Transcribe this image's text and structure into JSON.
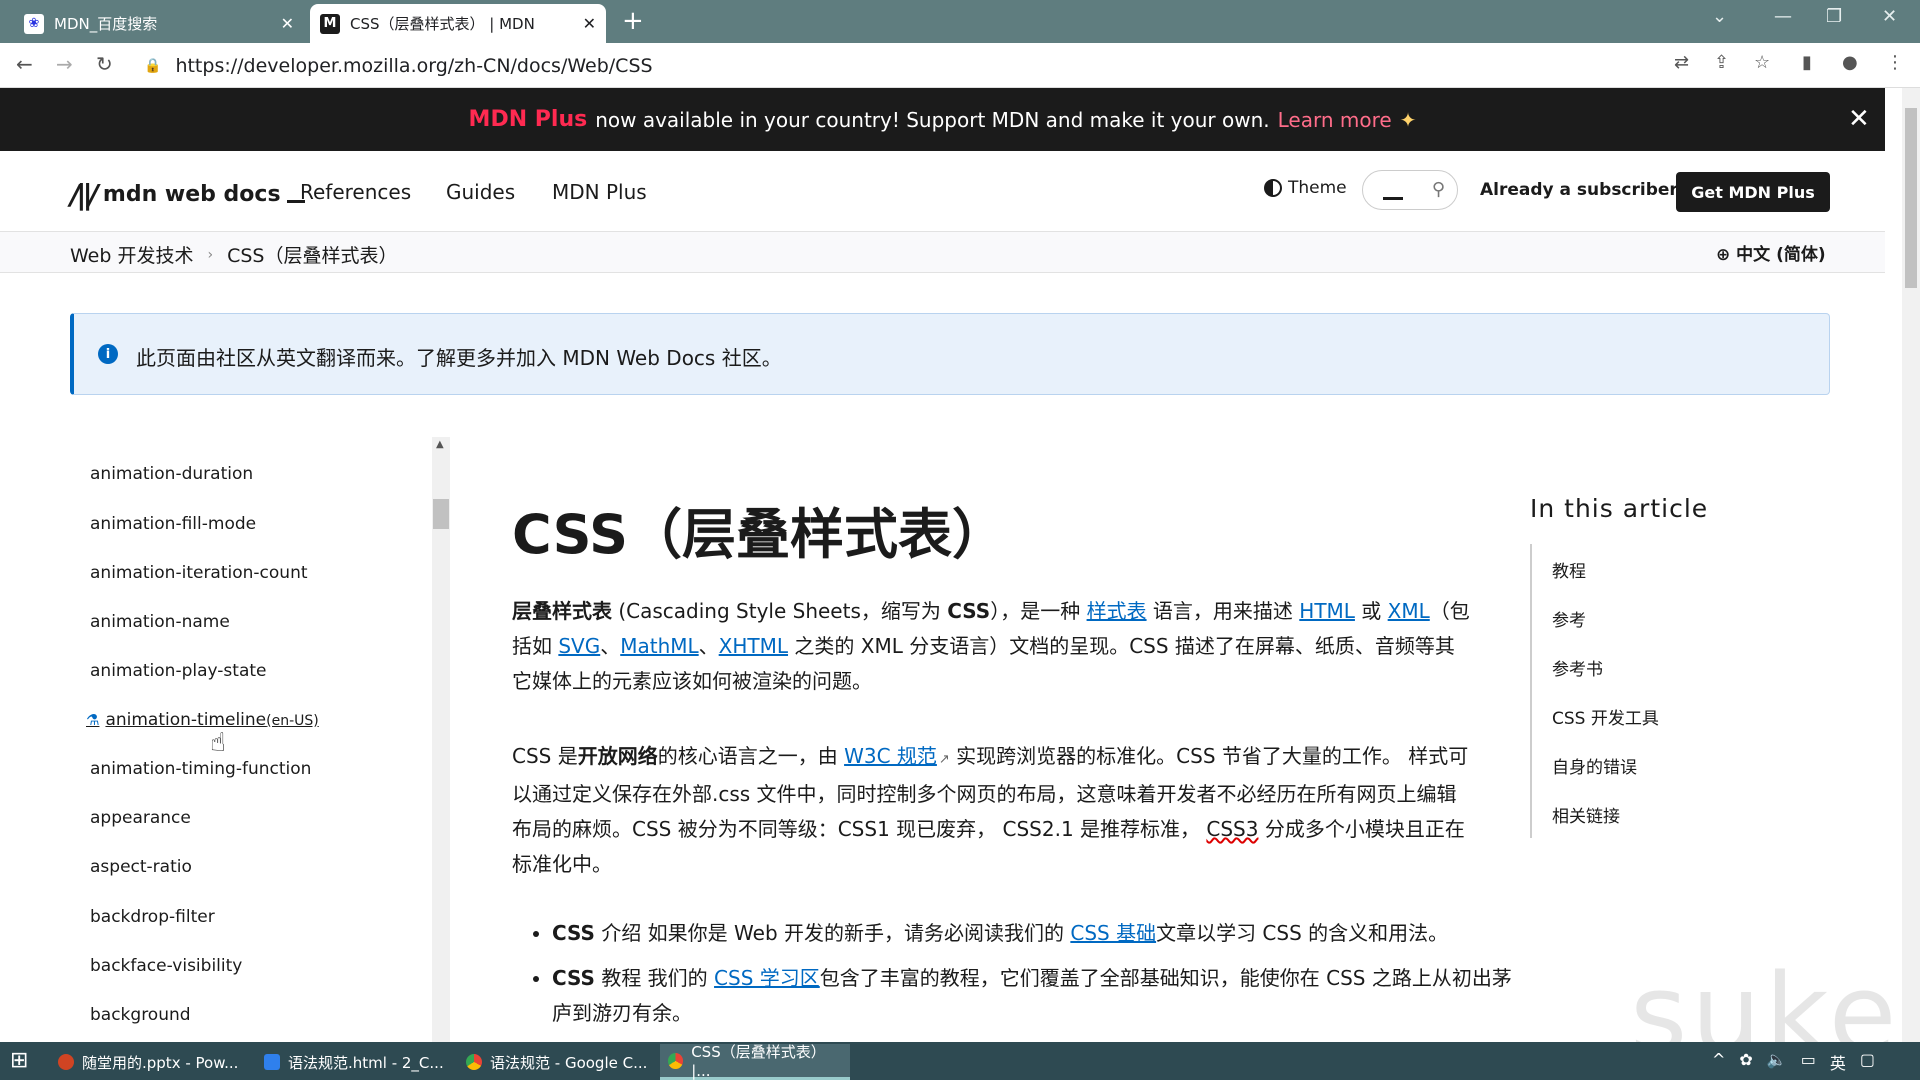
{
  "browser": {
    "tabs": [
      {
        "title": "MDN_百度搜索",
        "active": false
      },
      {
        "title": "CSS（层叠样式表） | MDN",
        "active": true
      }
    ],
    "url": "https://developer.mozilla.org/zh-CN/docs/Web/CSS"
  },
  "banner": {
    "brand": "MDN Plus",
    "text": "now available in your country! Support MDN and make it your own.",
    "link": "Learn more"
  },
  "header": {
    "logo": "mdn web docs",
    "nav": [
      "References",
      "Guides",
      "MDN Plus"
    ],
    "theme": "Theme",
    "subscriber": "Already a subscriber?",
    "cta": "Get MDN Plus"
  },
  "breadcrumb": {
    "items": [
      "Web 开发技术",
      "CSS（层叠样式表）"
    ],
    "language": "中文 (简体)"
  },
  "notice": {
    "text": "此页面由社区从英文翻译而来。了解更多并加入 MDN Web Docs 社区。"
  },
  "sidebar": {
    "items": [
      "animation-duration",
      "animation-fill-mode",
      "animation-iteration-count",
      "animation-name",
      "animation-play-state",
      "animation-timeline",
      "animation-timing-function",
      "appearance",
      "aspect-ratio",
      "backdrop-filter",
      "backface-visibility",
      "background"
    ],
    "experimental_suffix": "(en-US)"
  },
  "article": {
    "title": "CSS（层叠样式表）",
    "p1": {
      "t1": "层叠样式表",
      "t2": " (Cascading Style Sheets，缩写为 ",
      "t3": "CSS",
      "t4": "），是一种 ",
      "l1": "样式表",
      "t5": " 语言，用来描述 ",
      "l2": "HTML",
      "t6": " 或 ",
      "l3": "XML",
      "t7": "（包括如 ",
      "l4": "SVG",
      "t8": "、",
      "l5": "MathML",
      "t9": "、",
      "l6": "XHTML",
      "t10": " 之类的 XML 分支语言）文档的呈现。CSS 描述了在屏幕、纸质、音频等其它媒体上的元素应该如何被渲染的问题。"
    },
    "p2": {
      "t1": "CSS 是",
      "t2": "开放网络",
      "t3": "的核心语言之一，由 ",
      "l1": "W3C 规范",
      "t4": " 实现跨浏览器的标准化。CSS 节省了大量的工作。 样式可以通过定义保存在外部.css 文件中，同时控制多个网页的布局，这意味着开发者不必经历在所有网页上编辑布局的麻烦。CSS 被分为不同等级：CSS1 现已废弃， CSS2.1 是推荐标准， ",
      "l2": "CSS3",
      "t5": " 分成多个小模块且正在标准化中。"
    },
    "bullets": [
      {
        "b": "CSS",
        "t1": " 介绍 如果你是 Web 开发的新手，请务必阅读我们的 ",
        "l": "CSS 基础",
        "t2": "文章以学习 CSS 的含义和用法。"
      },
      {
        "b": "CSS",
        "t1": " 教程 我们的 ",
        "l": "CSS 学习区",
        "t2": "包含了丰富的教程，它们覆盖了全部基础知识，能使你在 CSS 之路上从初出茅庐到游刃有余。"
      }
    ]
  },
  "toc": {
    "title": "In this article",
    "items": [
      "教程",
      "参考",
      "参考书",
      "CSS 开发工具",
      "自身的错误",
      "相关链接"
    ]
  },
  "watermark": "suke",
  "taskbar": {
    "items": [
      {
        "label": "随堂用的.pptx - Pow...",
        "color": "#d04423"
      },
      {
        "label": "语法规范.html - 2_C...",
        "color": "#2f80ed"
      },
      {
        "label": "语法规范 - Google C...",
        "color": "#f4b400"
      },
      {
        "label": "CSS（层叠样式表） |...",
        "color": "#f4b400"
      }
    ],
    "ime": "英"
  }
}
